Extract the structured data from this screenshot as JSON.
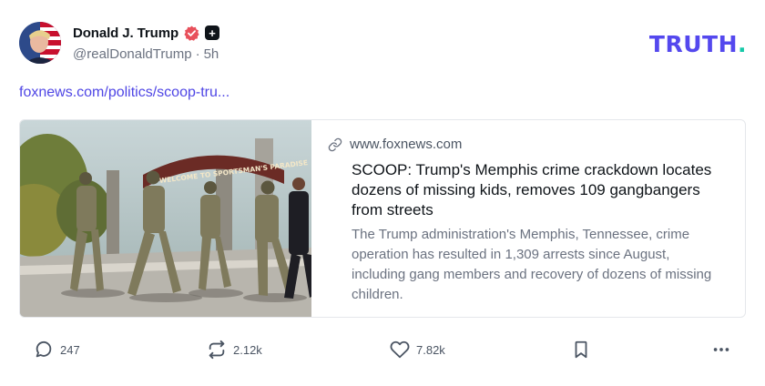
{
  "post": {
    "author_name": "Donald J. Trump",
    "handle": "@realDonaldTrump",
    "separator": "·",
    "time_ago": "5h",
    "link_text": "foxnews.com/politics/scoop-tru...",
    "badges": {
      "verified_color": "#e8505b",
      "plus_symbol": "+"
    }
  },
  "brand": {
    "logo_text": "TRUTH",
    "logo_dot": ".",
    "logo_color": "#5448ee",
    "dot_color": "#15c9a8"
  },
  "card": {
    "domain": "www.foxnews.com",
    "title": "SCOOP: Trump's Memphis crime crackdown locates dozens of missing kids, removes 109 gangbangers from streets",
    "description": "The Trump administration's Memphis, Tennessee, crime operation has resulted in 1,309 arrests since August, including gang members and recovery of dozens of missing children.",
    "image_sign_text": "WELCOME TO SPORTSMAN'S PARADISE"
  },
  "actions": {
    "replies": "247",
    "retruths": "2.12k",
    "likes": "7.82k"
  },
  "icons": [
    "verified-icon",
    "plus-icon",
    "link-icon",
    "reply-icon",
    "retruth-icon",
    "like-icon",
    "bookmark-icon",
    "more-icon"
  ]
}
